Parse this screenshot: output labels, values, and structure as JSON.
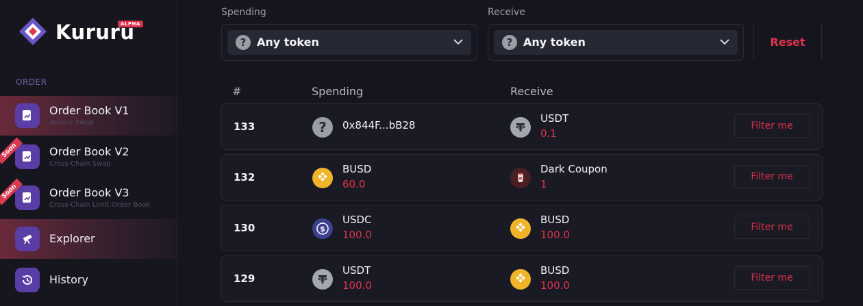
{
  "brand": {
    "name": "Kururu",
    "badge": "ALPHA"
  },
  "sidebar": {
    "section": "ORDER",
    "items": [
      {
        "title": "Order Book V1",
        "subtitle": "Atomic Swap",
        "active": true
      },
      {
        "title": "Order Book V2",
        "subtitle": "Cross-Chain Swap",
        "badge": "Soon"
      },
      {
        "title": "Order Book V3",
        "subtitle": "Cross-Chain Limit Order Book",
        "badge": "Soon"
      },
      {
        "title": "Explorer",
        "active": true
      },
      {
        "title": "History"
      }
    ]
  },
  "filters": {
    "spending_label": "Spending",
    "spending_value": "Any token",
    "receive_label": "Receive",
    "receive_value": "Any token",
    "reset_label": "Reset"
  },
  "table": {
    "headers": {
      "id": "#",
      "spending": "Spending",
      "receive": "Receive"
    },
    "action_label": "Filter me",
    "rows": [
      {
        "id": "133",
        "spend": {
          "token": "0x844F...bB28",
          "amount": "",
          "icon": "unknown-token"
        },
        "receive": {
          "token": "USDT",
          "amount": "0.1",
          "icon": "usdt"
        }
      },
      {
        "id": "132",
        "spend": {
          "token": "BUSD",
          "amount": "60.0",
          "icon": "busd"
        },
        "receive": {
          "token": "Dark Coupon",
          "amount": "1",
          "icon": "dark-coupon"
        }
      },
      {
        "id": "130",
        "spend": {
          "token": "USDC",
          "amount": "100.0",
          "icon": "usdc"
        },
        "receive": {
          "token": "BUSD",
          "amount": "100.0",
          "icon": "busd"
        }
      },
      {
        "id": "129",
        "spend": {
          "token": "USDT",
          "amount": "100.0",
          "icon": "usdt"
        },
        "receive": {
          "token": "BUSD",
          "amount": "100.0",
          "icon": "busd"
        }
      }
    ]
  },
  "colors": {
    "accent": "#e0344f",
    "background": "#14151d",
    "nav_icon": "#5a3ea6"
  }
}
